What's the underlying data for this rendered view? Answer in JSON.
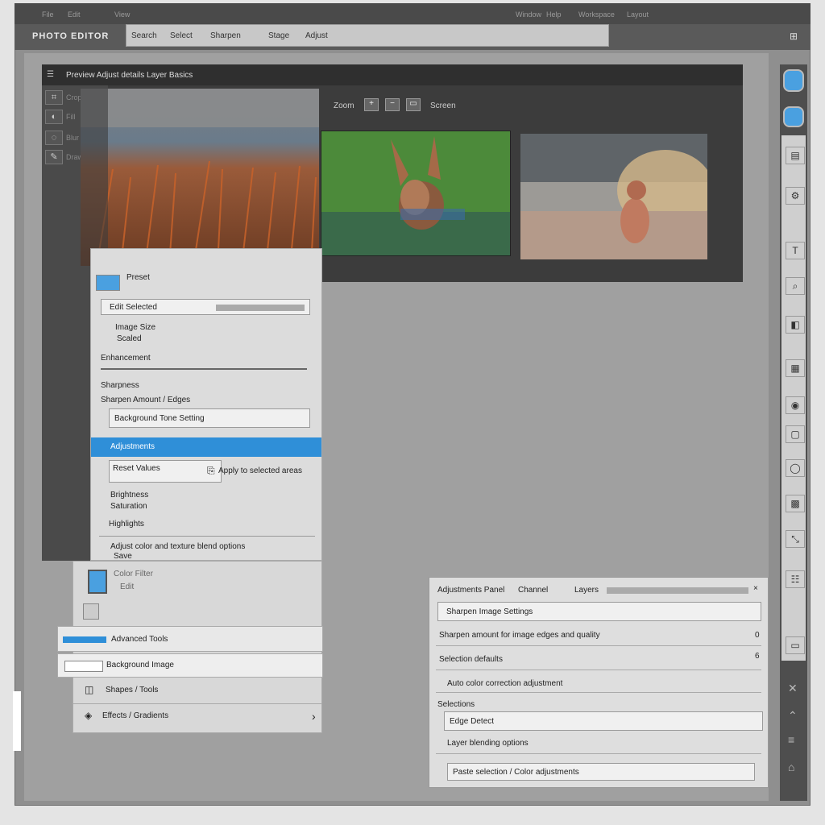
{
  "topbar": {
    "menu_items": [
      "File",
      "Edit",
      "View"
    ],
    "right_items": [
      "Window",
      "Help",
      "Workspace",
      "Layout"
    ]
  },
  "toolbar": {
    "app_title": "PHOTO EDITOR",
    "search_tokens": [
      "Search",
      "Select",
      "Sharpen",
      "Stage",
      "Adjust"
    ]
  },
  "workspace": {
    "header": "Preview  Adjust details  Layer Basics",
    "left_tools": [
      "Crop",
      "Fill",
      "Blur",
      "Draw"
    ],
    "view_label": "Zoom",
    "view_right_label": "Screen"
  },
  "panel": {
    "preset_label": "Preset",
    "selected_field": "Edit Selected",
    "size_label": "Image Size",
    "size_sub": "Scaled",
    "section_enhancement": "Enhancement",
    "section_sharpness": "Sharpness",
    "sharpness_desc": "Sharpen Amount / Edges",
    "tone_field": "Background Tone Setting",
    "highlight_item": "Adjustments",
    "adjust_field": "Reset Values",
    "adjust_hint": "Apply to selected areas",
    "sub1": "Brightness",
    "sub2": "Saturation",
    "sub3": "Highlights",
    "footer_text": "Adjust color and texture blend options",
    "footer_sub": "Save",
    "thumb_title": "Color Filter",
    "thumb_sub": "Edit",
    "item_active": "Advanced Tools",
    "item_2": "Background Image",
    "item_3": "Shapes / Tools",
    "item_4": "Effects / Gradients",
    "arrow": "›"
  },
  "rightpanel": {
    "tab1": "Adjustments Panel",
    "tab2": "Channel",
    "tab3": "Layers",
    "field1": "Sharpen Image Settings",
    "row1": "Sharpen amount for image edges and quality",
    "row1_val": "0",
    "row2": "Selection defaults",
    "row2_val": "6",
    "row3": "Auto color correction adjustment",
    "section": "Selections",
    "field2": "Edge Detect",
    "row4": "Layer blending options",
    "field3": "Paste selection / Color adjustments"
  },
  "photos": [
    {
      "name": "autumn-grass-photo"
    },
    {
      "name": "donkey-in-water-photo"
    },
    {
      "name": "foggy-river-donkey-photo"
    }
  ],
  "colors": {
    "accent": "#2f8fd8",
    "panel_bg": "#dcdcdc",
    "workspace_bg": "#3c3c3c"
  },
  "icons": [
    "menu-icon",
    "crop-icon",
    "fill-icon",
    "blur-icon",
    "draw-icon",
    "zoom-in-icon",
    "zoom-out-icon",
    "fit-icon",
    "layers-icon",
    "brush-icon",
    "eraser-icon",
    "history-icon",
    "settings-icon",
    "gradient-icon",
    "shape-icon",
    "text-icon"
  ]
}
